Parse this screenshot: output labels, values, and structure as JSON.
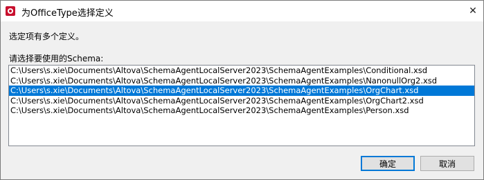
{
  "window": {
    "title": "为OfficeType选择定义"
  },
  "message": "选定项有多个定义。",
  "list": {
    "label": "请选择要使用的Schema:",
    "items": [
      "C:\\Users\\s.xie\\Documents\\Altova\\SchemaAgentLocalServer2023\\SchemaAgentExamples\\Conditional.xsd",
      "C:\\Users\\s.xie\\Documents\\Altova\\SchemaAgentLocalServer2023\\SchemaAgentExamples\\NanonullOrg2.xsd",
      "C:\\Users\\s.xie\\Documents\\Altova\\SchemaAgentLocalServer2023\\SchemaAgentExamples\\OrgChart.xsd",
      "C:\\Users\\s.xie\\Documents\\Altova\\SchemaAgentLocalServer2023\\SchemaAgentExamples\\OrgChart2.xsd",
      "C:\\Users\\s.xie\\Documents\\Altova\\SchemaAgentLocalServer2023\\SchemaAgentExamples\\Person.xsd"
    ],
    "selected_index": 2
  },
  "buttons": {
    "ok": "确定",
    "cancel": "取消"
  },
  "icons": {
    "app": "altova-app-icon",
    "close": "close-icon"
  },
  "colors": {
    "selection": "#0078d7",
    "default_button_border": "#0078d7"
  }
}
